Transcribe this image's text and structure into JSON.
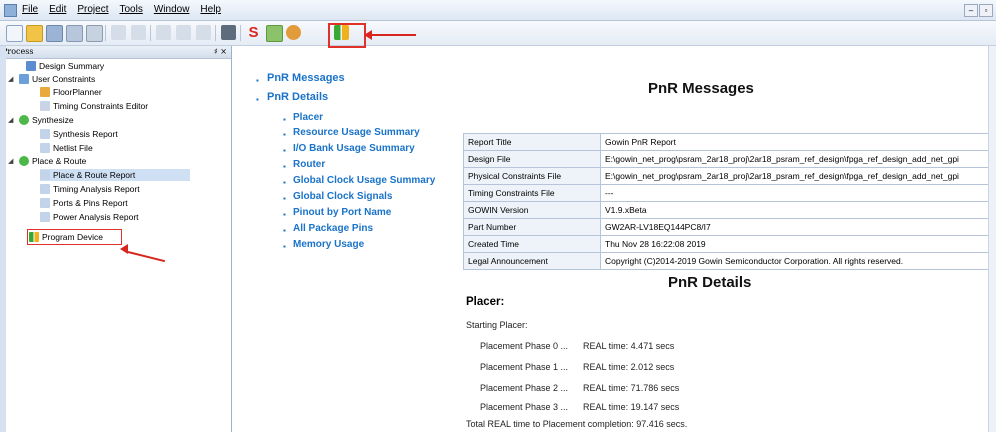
{
  "menu": [
    "File",
    "Edit",
    "Project",
    "Tools",
    "Window",
    "Help"
  ],
  "panel": {
    "title": "Process",
    "controls": "♯ ×"
  },
  "tree": [
    {
      "label": "Design Summary"
    },
    {
      "label": "User Constraints"
    },
    {
      "label": "FloorPlanner"
    },
    {
      "label": "Timing Constraints Editor"
    },
    {
      "label": "Synthesize"
    },
    {
      "label": "Synthesis Report"
    },
    {
      "label": "Netlist File"
    },
    {
      "label": "Place & Route"
    },
    {
      "label": "Place & Route Report"
    },
    {
      "label": "Timing Analysis Report"
    },
    {
      "label": "Ports & Pins Report"
    },
    {
      "label": "Power Analysis Report"
    },
    {
      "label": "Program Device"
    }
  ],
  "nav": {
    "top": [
      "PnR Messages",
      "PnR Details"
    ],
    "sub": [
      "Placer",
      "Resource Usage Summary",
      "I/O Bank Usage Summary",
      "Router",
      "Global Clock Usage Summary",
      "Global Clock Signals",
      "Pinout by Port Name",
      "All Package Pins",
      "Memory Usage"
    ]
  },
  "messages": {
    "heading": "PnR Messages",
    "rows": [
      [
        "Report Title",
        "Gowin PnR Report"
      ],
      [
        "Design File",
        "E:\\gowin_net_prog\\psram_2ar18_proj\\2ar18_psram_ref_design\\fpga_ref_design_add_net_gpi"
      ],
      [
        "Physical Constraints File",
        "E:\\gowin_net_prog\\psram_2ar18_proj\\2ar18_psram_ref_design\\fpga_ref_design_add_net_gpi"
      ],
      [
        "Timing Constraints File",
        "---"
      ],
      [
        "GOWIN Version",
        "V1.9.xBeta"
      ],
      [
        "Part Number",
        "GW2AR-LV18EQ144PC8/I7"
      ],
      [
        "Created Time",
        "Thu Nov 28 16:22:08 2019"
      ],
      [
        "Legal Announcement",
        "Copyright (C)2014-2019 Gowin Semiconductor Corporation. All rights reserved."
      ]
    ]
  },
  "details": {
    "heading": "PnR Details",
    "placer_heading": "Placer:",
    "starting": "Starting Placer:",
    "phases": [
      [
        "Placement Phase 0 ...",
        "REAL time: 4.471 secs"
      ],
      [
        "Placement Phase 1 ...",
        "REAL time: 2.012 secs"
      ],
      [
        "Placement Phase 2 ...",
        "REAL time: 71.786 secs"
      ],
      [
        "Placement Phase 3 ...",
        "REAL time: 19.147 secs"
      ]
    ],
    "total": "Total REAL time to Placement completion: 97.416 secs."
  }
}
